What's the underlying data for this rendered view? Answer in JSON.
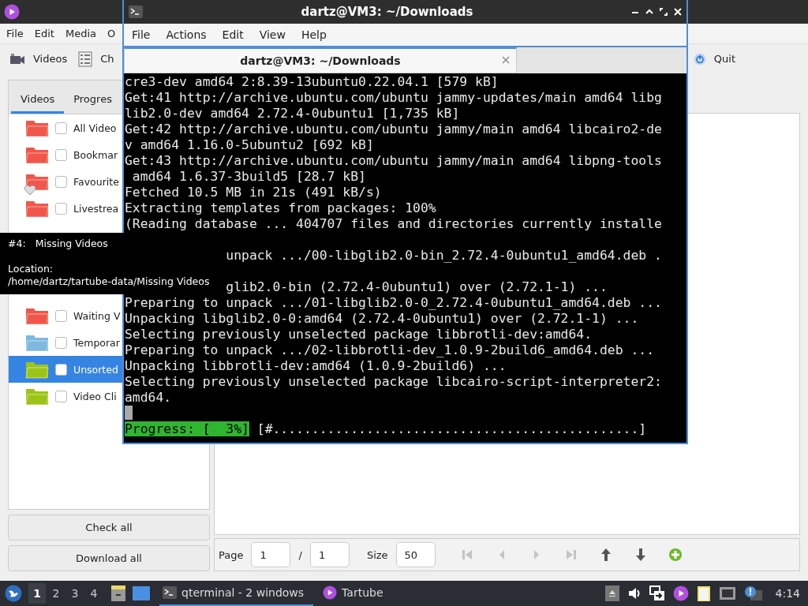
{
  "tartube": {
    "menu": [
      "File",
      "Edit",
      "Media",
      "O"
    ],
    "toolbar": [
      "Videos",
      "Ch"
    ],
    "quit": "Quit",
    "tabs": [
      {
        "label": "Videos",
        "selected": true
      },
      {
        "label": "Progres",
        "selected": false
      }
    ],
    "folders": [
      {
        "kind": "folder",
        "label": "All Video",
        "color": "#f0574a",
        "checked": false,
        "selected": false
      },
      {
        "kind": "folder",
        "label": "Bookmar",
        "color": "#f0574a",
        "checked": false,
        "selected": false
      },
      {
        "kind": "favourite",
        "label": "Favourite",
        "color": "#f0574a",
        "checked": false,
        "selected": false
      },
      {
        "kind": "folder",
        "label": "Livestrea",
        "color": "#f0574a",
        "checked": false,
        "selected": false
      },
      {
        "kind": "covered"
      },
      {
        "kind": "covered"
      },
      {
        "kind": "covered"
      },
      {
        "kind": "folder",
        "label": "Waiting V",
        "color": "#f0574a",
        "checked": false,
        "selected": false
      },
      {
        "kind": "folder",
        "label": "Temporar",
        "color": "#7db9de",
        "checked": false,
        "selected": false
      },
      {
        "kind": "folder",
        "label": "Unsorted",
        "color": "#9cc417",
        "checked": false,
        "selected": true
      },
      {
        "kind": "folder",
        "label": "Video Cli",
        "color": "#9cc417",
        "checked": false,
        "selected": false
      }
    ],
    "buttons": [
      "Check all",
      "Download all"
    ],
    "pager": {
      "page_label": "Page",
      "page": "1",
      "separator": "/",
      "total": "1",
      "size_label": "Size",
      "size": "50"
    },
    "nav": [
      {
        "disabled": true
      },
      {
        "disabled": true
      },
      {
        "disabled": true
      },
      {
        "disabled": true
      },
      {
        "disabled": false
      },
      {
        "disabled": false
      },
      {
        "disabled": false
      }
    ]
  },
  "terminal": {
    "title": "dartz@VM3: ~/Downloads",
    "menu": [
      "File",
      "Actions",
      "Edit",
      "View",
      "Help"
    ],
    "tab": "dartz@VM3: ~/Downloads",
    "lines": [
      {
        "text": "cre3-dev amd64 2:8.39-13ubuntu0.22.04.1 [579 kB]"
      },
      {
        "text": "Get:41 http://archive.ubuntu.com/ubuntu jammy-updates/main amd64 libg"
      },
      {
        "text": "lib2.0-dev amd64 2.72.4-0ubuntu1 [1,735 kB]"
      },
      {
        "text": "Get:42 http://archive.ubuntu.com/ubuntu jammy/main amd64 libcairo2-de"
      },
      {
        "text": "v amd64 1.16.0-5ubuntu2 [692 kB]"
      },
      {
        "text": "Get:43 http://archive.ubuntu.com/ubuntu jammy/main amd64 libpng-tools"
      },
      {
        "text": " amd64 1.6.37-3build5 [28.7 kB]"
      },
      {
        "text": "Fetched 10.5 MB in 21s (491 kB/s)"
      },
      {
        "text": "Extracting templates from packages: 100%"
      },
      {
        "text": "(Reading database ... 404707 files and directories currently installe"
      },
      {
        "kind": "hidden"
      },
      {
        "kind": "covered_start",
        "text": "unpack .../00-libglib2.0-bin_2.72.4-0ubuntu1_amd64.deb ."
      },
      {
        "kind": "hidden"
      },
      {
        "kind": "covered_start",
        "text": "glib2.0-bin (2.72.4-0ubuntu1) over (2.72.1-1) ..."
      },
      {
        "text": "Preparing to unpack .../01-libglib2.0-0_2.72.4-0ubuntu1_amd64.deb ..."
      },
      {
        "text": "Unpacking libglib2.0-0:amd64 (2.72.4-0ubuntu1) over (2.72.1-1) ..."
      },
      {
        "text": "Selecting previously unselected package libbrotli-dev:amd64."
      },
      {
        "text": "Preparing to unpack .../02-libbrotli-dev_1.0.9-2build6_amd64.deb ..."
      },
      {
        "text": "Unpacking libbrotli-dev:amd64 (1.0.9-2build6) ..."
      },
      {
        "text": "Selecting previously unselected package libcairo-script-interpreter2:"
      },
      {
        "text": "amd64."
      },
      {
        "kind": "cursor"
      }
    ],
    "progress": {
      "label": "Progress: [  3%]",
      "bar": " [#...............................................]"
    }
  },
  "tooltip": {
    "number": "#4:",
    "name": "Missing Videos",
    "location_label": "Location:",
    "path": "/home/dartz/tartube-data/Missing Videos"
  },
  "taskbar": {
    "workspaces": [
      {
        "label": "1",
        "selected": true
      },
      {
        "label": "2",
        "selected": false
      },
      {
        "label": "3",
        "selected": false
      },
      {
        "label": "4",
        "selected": false
      }
    ],
    "tasks": [
      {
        "label": "qterminal - 2 windows",
        "selected": true
      },
      {
        "label": "Tartube",
        "selected": false
      }
    ],
    "clock": "4:14"
  }
}
